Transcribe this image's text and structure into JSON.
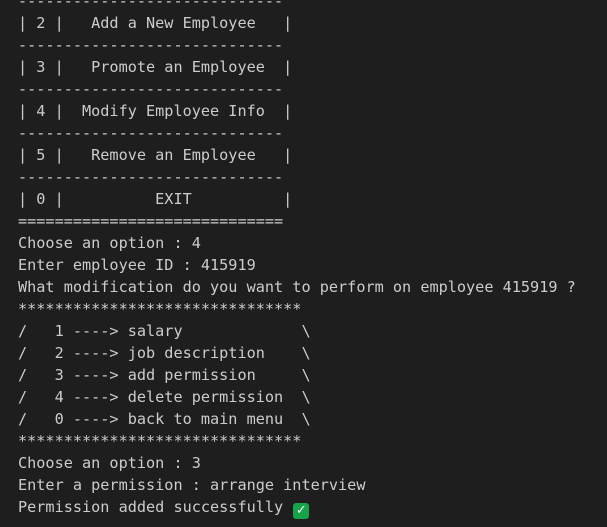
{
  "lines": [
    "-----------------------------",
    "| 2 |   Add a New Employee   |",
    "-----------------------------",
    "| 3 |   Promote an Employee  |",
    "-----------------------------",
    "| 4 |  Modify Employee Info  |",
    "-----------------------------",
    "| 5 |   Remove an Employee   |",
    "-----------------------------",
    "| 0 |          EXIT          |",
    "=============================",
    "Choose an option : 4",
    "Enter employee ID : 415919",
    "What modification do you want to perform on employee 415919 ?",
    "*******************************",
    "/   1 ----> salary             \\",
    "/   2 ----> job description    \\",
    "/   3 ----> add permission     \\",
    "/   4 ----> delete permission  \\",
    "/   0 ----> back to main menu  \\",
    "*******************************",
    "Choose an option : 3",
    "Enter a permission : arrange interview",
    "Permission added successfully "
  ],
  "success_icon": {
    "name": "check-mark-icon",
    "glyph": "✓",
    "color": "#16a34a"
  }
}
